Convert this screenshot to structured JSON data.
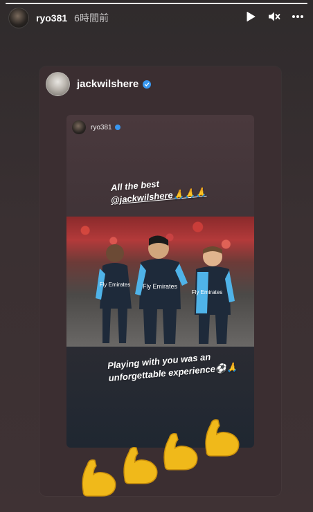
{
  "story": {
    "username": "ryo381",
    "timestamp": "6時間前"
  },
  "shared_post": {
    "username": "jackwilshere",
    "verified": true,
    "inner_story": {
      "username": "ryo381",
      "verified": true,
      "text_line1": "All the best",
      "mention": "@jackwilshere",
      "text_line1_emoji": "🙏🙏🙏",
      "text_line2": "Playing with you was an unforgettable experience⚽🙏",
      "photo_jersey_text": "Fly Emirates"
    },
    "sticker": "💪💪💪💪"
  },
  "icons": {
    "play": "play-icon",
    "mute": "mute-icon",
    "more": "more-icon"
  },
  "colors": {
    "verified": "#3897f0",
    "jersey_blue": "#1e2a3a",
    "jersey_accent": "#4fb3e8",
    "emoji": "#f0b91a"
  }
}
